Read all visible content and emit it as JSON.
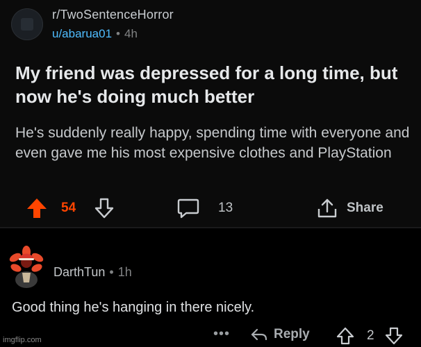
{
  "post": {
    "subreddit": "r/TwoSentenceHorror",
    "author": "u/abarua01",
    "separator": "•",
    "age": "4h",
    "title": "My friend was depressed for a long time, but now he's doing much better",
    "body": "He's suddenly really happy, spending time with everyone and even gave me his most expensive clothes and PlayStation",
    "score": "54",
    "comment_count": "13",
    "share_label": "Share",
    "icons": {
      "upvote": "upvote-arrow-icon",
      "downvote": "downvote-arrow-icon",
      "comment": "comment-bubble-icon",
      "share": "share-icon"
    },
    "colors": {
      "upvote_active": "#ff4500",
      "username": "#4fbcff"
    }
  },
  "comment": {
    "author": "DarthTun",
    "separator": "•",
    "age": "1h",
    "text": "Good thing he's hanging in there nicely.",
    "more_label": "•••",
    "reply_label": "Reply",
    "score": "2"
  },
  "watermark": "imgflip.com"
}
